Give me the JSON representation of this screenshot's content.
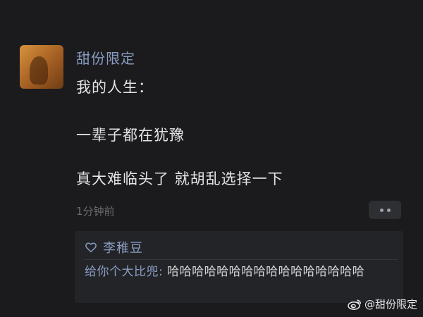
{
  "post": {
    "username": "甜份限定",
    "lines": [
      "我的人生：",
      "一辈子都在犹豫",
      "真大难临头了 就胡乱选择一下"
    ],
    "timestamp": "1分钟前"
  },
  "reply": {
    "liker": "李稚豆",
    "comment_author": "给你个大比兜:",
    "comment_text": " 哈哈哈哈哈哈哈哈哈哈哈哈哈哈哈哈"
  },
  "watermark": {
    "text": "@甜份限定"
  },
  "colors": {
    "background": "#1b1b1d",
    "accent_name": "#8a9cc4",
    "text": "#e4e4e6",
    "muted": "#6b6b70",
    "reply_background": "#232427"
  },
  "icons": {
    "like": "heart-icon",
    "more": "more-icon",
    "watermark": "weibo-icon"
  }
}
